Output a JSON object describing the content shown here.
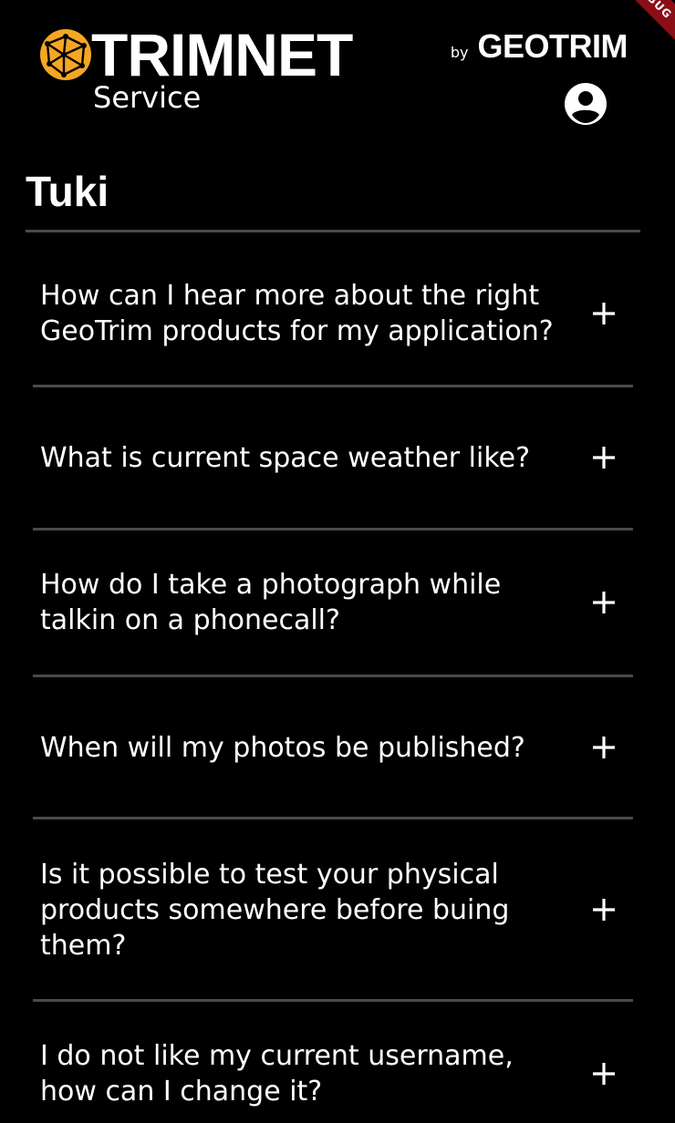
{
  "debug_banner": "DEBUG",
  "header": {
    "logo_text": "TRIMNET",
    "logo_sub": "Service",
    "by_label": "by",
    "brand": "GEOTRIM",
    "logo_color": "#f5a623"
  },
  "page": {
    "title": "Tuki"
  },
  "faq": [
    {
      "question": "How can I hear more about the right GeoTrim products for my application?"
    },
    {
      "question": "What is current space weather like?"
    },
    {
      "question": "How do I take a photograph while talkin on a phonecall?"
    },
    {
      "question": "When will my photos be published?"
    },
    {
      "question": "Is it possible to test your physical products somewhere before buing them?"
    },
    {
      "question": "I do not like my current username, how can I change it?"
    }
  ],
  "icons": {
    "account": "account-circle-icon",
    "expand": "plus-icon"
  }
}
